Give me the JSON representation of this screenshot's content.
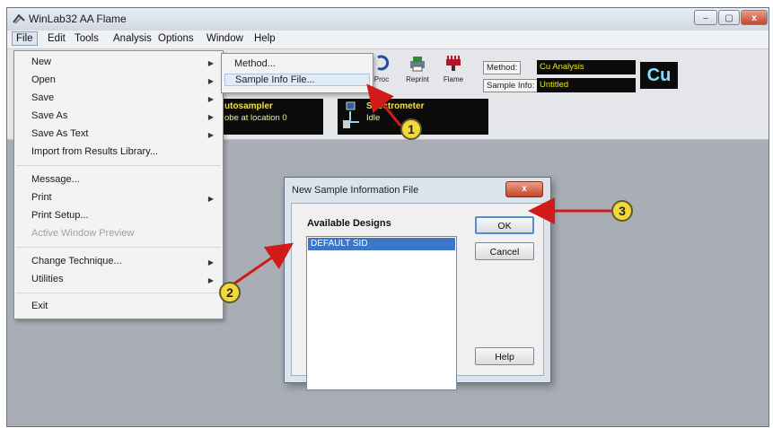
{
  "window": {
    "title": "WinLab32 AA Flame",
    "controls": [
      "–",
      "▢",
      "x"
    ]
  },
  "menubar": [
    "File",
    "Edit",
    "Tools",
    "Analysis",
    "Options",
    "Window",
    "Help"
  ],
  "toolbar": {
    "tools": [
      "Proc",
      "Reprint",
      "Flame"
    ],
    "method_label": "Method:",
    "method_value": "Cu Analysis",
    "sample_info_label": "Sample Info:",
    "sample_info_value": "Untitled",
    "element": "Cu"
  },
  "status_panels": {
    "autosampler_title": "utosampler",
    "autosampler_status": "obe at location 0",
    "spectrometer_title": "Spectrometer",
    "spectrometer_status": "Idle"
  },
  "file_menu": {
    "items": [
      "New",
      "Open",
      "Save",
      "Save As",
      "Save As Text",
      "Import from Results Library...",
      "Message...",
      "Print",
      "Print Setup...",
      "Active Window Preview",
      "Change Technique...",
      "Utilities",
      "Exit"
    ]
  },
  "new_submenu": {
    "items": [
      "Method...",
      "Sample Info File..."
    ]
  },
  "dialog": {
    "title": "New Sample Information File",
    "close": "x",
    "group_label": "Available Designs",
    "designs": [
      "DEFAULT SID"
    ],
    "ok": "OK",
    "cancel": "Cancel",
    "help": "Help"
  },
  "callouts": [
    "1",
    "2",
    "3"
  ],
  "colors": {
    "callout": "#f3d83c",
    "arrow": "#d11a1a",
    "selection": "#3b76c9",
    "status_text": "#f1e14b"
  }
}
